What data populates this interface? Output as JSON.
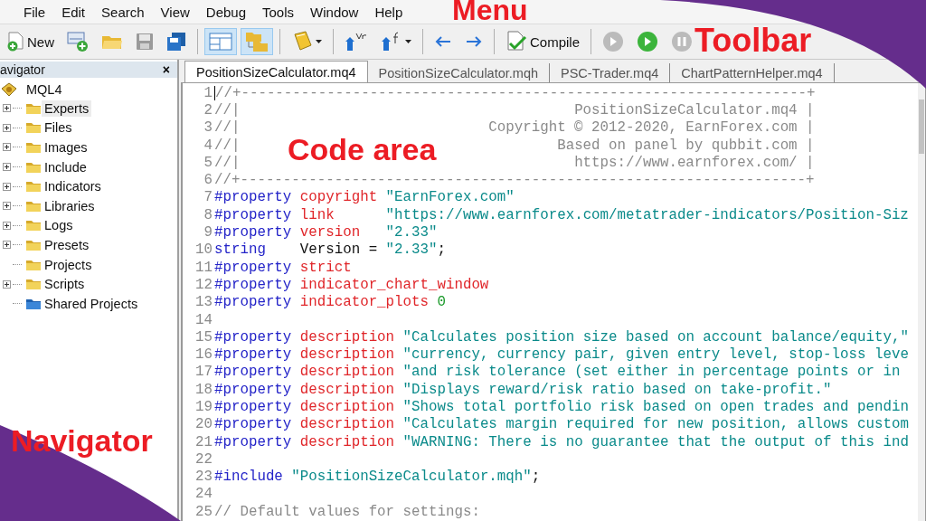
{
  "menu": [
    {
      "label": "File"
    },
    {
      "label": "Edit"
    },
    {
      "label": "Search"
    },
    {
      "label": "View"
    },
    {
      "label": "Debug"
    },
    {
      "label": "Tools"
    },
    {
      "label": "Window"
    },
    {
      "label": "Help"
    }
  ],
  "toolbar": {
    "new_label": "New",
    "compile_label": "Compile",
    "toggles": [
      {
        "on": true
      },
      {
        "on": true
      }
    ]
  },
  "navigator": {
    "title": "avigator",
    "close": "×",
    "root": {
      "label": "MQL4",
      "expanded": true,
      "children": [
        {
          "label": "Experts",
          "kind": "folder",
          "expanded": false,
          "selected": true
        },
        {
          "label": "Files",
          "kind": "folder",
          "expanded": false,
          "selected": false
        },
        {
          "label": "Images",
          "kind": "folder",
          "expanded": false,
          "selected": false
        },
        {
          "label": "Include",
          "kind": "folder",
          "expanded": false,
          "selected": false
        },
        {
          "label": "Indicators",
          "kind": "folder",
          "expanded": false,
          "selected": false
        },
        {
          "label": "Libraries",
          "kind": "folder",
          "expanded": false,
          "selected": false
        },
        {
          "label": "Logs",
          "kind": "folder",
          "expanded": false,
          "selected": false
        },
        {
          "label": "Presets",
          "kind": "folder",
          "expanded": false,
          "selected": false
        },
        {
          "label": "Projects",
          "kind": "empty",
          "selected": false
        },
        {
          "label": "Scripts",
          "kind": "folder",
          "expanded": false,
          "selected": false
        },
        {
          "label": "Shared Projects",
          "kind": "shared",
          "selected": false
        }
      ]
    }
  },
  "tabs": [
    {
      "label": "PositionSizeCalculator.mq4",
      "selected": true
    },
    {
      "label": "PositionSizeCalculator.mqh",
      "selected": false
    },
    {
      "label": "PSC-Trader.mq4",
      "selected": false
    },
    {
      "label": "ChartPatternHelper.mq4",
      "selected": false
    }
  ],
  "code": {
    "lines": [
      {
        "number": "1",
        "tokens": [
          {
            "kind": "comment",
            "text": "//+------------------------------------------------------------------+"
          }
        ]
      },
      {
        "number": "2",
        "tokens": [
          {
            "kind": "comment",
            "text": "//|"
          },
          {
            "kind": "comment-right",
            "text": "PositionSizeCalculator.mq4 |"
          }
        ]
      },
      {
        "number": "3",
        "tokens": [
          {
            "kind": "comment",
            "text": "//|"
          },
          {
            "kind": "comment-right",
            "text": "Copyright © 2012-2020, EarnForex.com |"
          }
        ]
      },
      {
        "number": "4",
        "tokens": [
          {
            "kind": "comment",
            "text": "//|"
          },
          {
            "kind": "comment-right",
            "text": "Based on panel by qubbit.com |"
          }
        ]
      },
      {
        "number": "5",
        "tokens": [
          {
            "kind": "comment",
            "text": "//|"
          },
          {
            "kind": "comment-right",
            "text": "https://www.earnforex.com/ |"
          }
        ]
      },
      {
        "number": "6",
        "tokens": [
          {
            "kind": "comment",
            "text": "//+------------------------------------------------------------------+"
          }
        ]
      },
      {
        "number": "7",
        "tokens": [
          {
            "kind": "keyword",
            "text": "#property "
          },
          {
            "kind": "property",
            "text": "copyright "
          },
          {
            "kind": "string",
            "text": "\"EarnForex.com\""
          }
        ]
      },
      {
        "number": "8",
        "tokens": [
          {
            "kind": "keyword",
            "text": "#property "
          },
          {
            "kind": "property",
            "text": "link      "
          },
          {
            "kind": "string",
            "text": "\"https://www.earnforex.com/metatrader-indicators/Position-Siz"
          }
        ]
      },
      {
        "number": "9",
        "tokens": [
          {
            "kind": "keyword",
            "text": "#property "
          },
          {
            "kind": "property",
            "text": "version   "
          },
          {
            "kind": "string",
            "text": "\"2.33\""
          }
        ]
      },
      {
        "number": "10",
        "tokens": [
          {
            "kind": "keyword",
            "text": "string"
          },
          {
            "kind": "plain",
            "text": "    Version = "
          },
          {
            "kind": "string",
            "text": "\"2.33\""
          },
          {
            "kind": "plain",
            "text": ";"
          }
        ]
      },
      {
        "number": "11",
        "tokens": [
          {
            "kind": "keyword",
            "text": "#property "
          },
          {
            "kind": "property",
            "text": "strict"
          }
        ]
      },
      {
        "number": "12",
        "tokens": [
          {
            "kind": "keyword",
            "text": "#property "
          },
          {
            "kind": "property",
            "text": "indicator_chart_window"
          }
        ]
      },
      {
        "number": "13",
        "tokens": [
          {
            "kind": "keyword",
            "text": "#property "
          },
          {
            "kind": "property",
            "text": "indicator_plots "
          },
          {
            "kind": "number",
            "text": "0"
          }
        ]
      },
      {
        "number": "14"
      },
      {
        "number": "15",
        "tokens": [
          {
            "kind": "keyword",
            "text": "#property "
          },
          {
            "kind": "property",
            "text": "description "
          },
          {
            "kind": "string",
            "text": "\"Calculates position size based on account balance/equity,\""
          }
        ]
      },
      {
        "number": "16",
        "tokens": [
          {
            "kind": "keyword",
            "text": "#property "
          },
          {
            "kind": "property",
            "text": "description "
          },
          {
            "kind": "string",
            "text": "\"currency, currency pair, given entry level, stop-loss leve"
          }
        ]
      },
      {
        "number": "17",
        "tokens": [
          {
            "kind": "keyword",
            "text": "#property "
          },
          {
            "kind": "property",
            "text": "description "
          },
          {
            "kind": "string",
            "text": "\"and risk tolerance (set either in percentage points or in"
          }
        ]
      },
      {
        "number": "18",
        "tokens": [
          {
            "kind": "keyword",
            "text": "#property "
          },
          {
            "kind": "property",
            "text": "description "
          },
          {
            "kind": "string",
            "text": "\"Displays reward/risk ratio based on take-profit.\""
          }
        ]
      },
      {
        "number": "19",
        "tokens": [
          {
            "kind": "keyword",
            "text": "#property "
          },
          {
            "kind": "property",
            "text": "description "
          },
          {
            "kind": "string",
            "text": "\"Shows total portfolio risk based on open trades and pendin"
          }
        ]
      },
      {
        "number": "20",
        "tokens": [
          {
            "kind": "keyword",
            "text": "#property "
          },
          {
            "kind": "property",
            "text": "description "
          },
          {
            "kind": "string",
            "text": "\"Calculates margin required for new position, allows custom"
          }
        ]
      },
      {
        "number": "21",
        "tokens": [
          {
            "kind": "keyword",
            "text": "#property "
          },
          {
            "kind": "property",
            "text": "description "
          },
          {
            "kind": "string",
            "text": "\"WARNING: There is no guarantee that the output of this ind"
          }
        ]
      },
      {
        "number": "22"
      },
      {
        "number": "23",
        "tokens": [
          {
            "kind": "keyword",
            "text": "#include "
          },
          {
            "kind": "string",
            "text": "\"PositionSizeCalculator.mqh\""
          },
          {
            "kind": "plain",
            "text": ";"
          }
        ]
      },
      {
        "number": "24"
      },
      {
        "number": "25",
        "tokens": [
          {
            "kind": "comment",
            "text": "// Default values for settings:"
          }
        ]
      }
    ]
  },
  "annotations": [
    {
      "label": "Menu",
      "kind": "menu"
    },
    {
      "label": "Toolbar",
      "kind": "toolbar"
    },
    {
      "label": "Code area",
      "kind": "code"
    },
    {
      "label": "Navigator",
      "kind": "navigator"
    }
  ]
}
